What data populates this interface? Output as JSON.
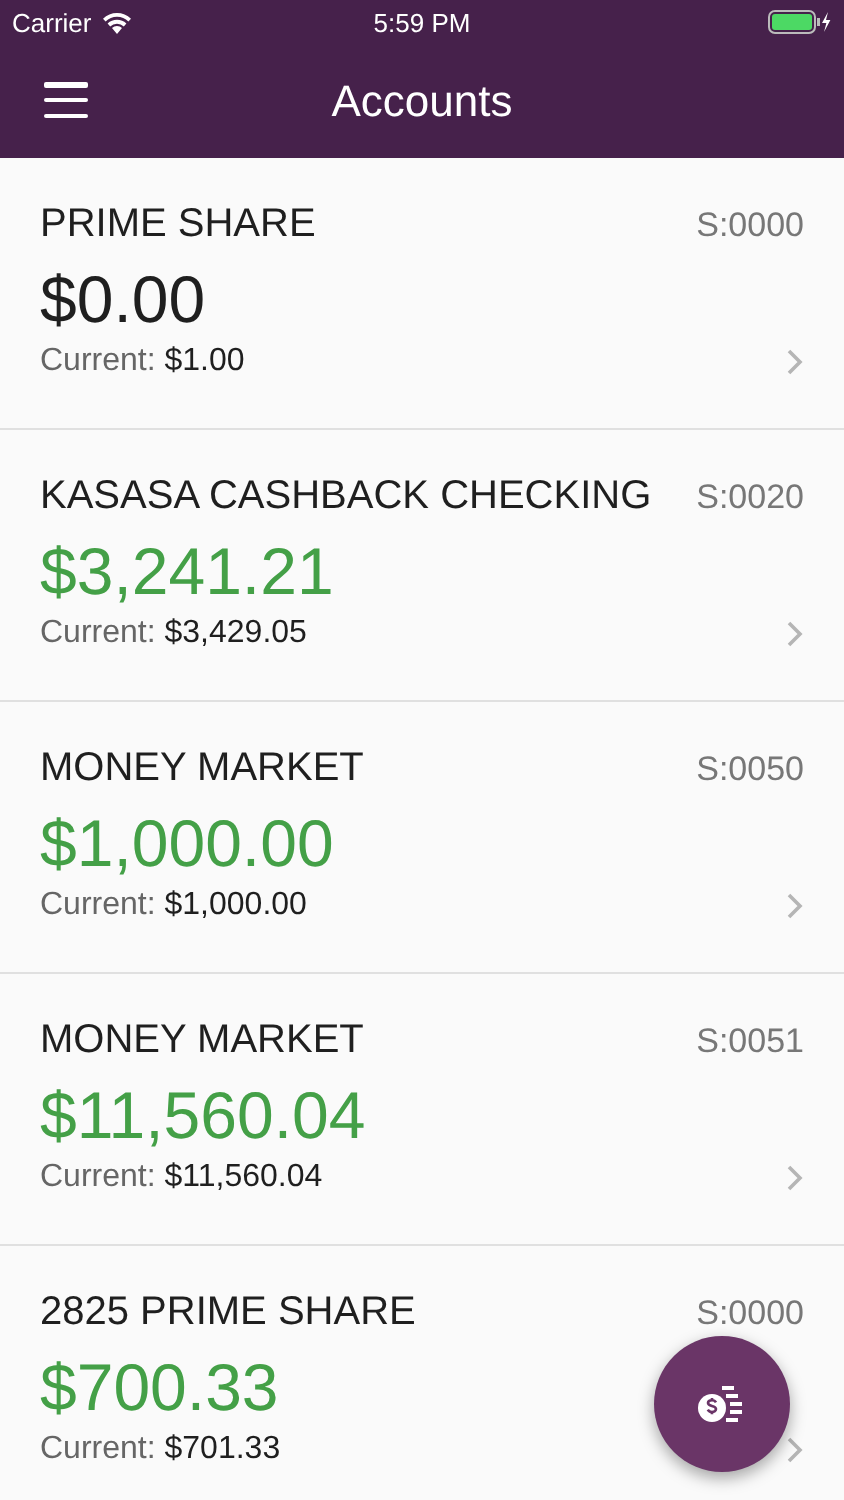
{
  "status_bar": {
    "carrier": "Carrier",
    "time": "5:59 PM"
  },
  "header": {
    "title": "Accounts"
  },
  "accounts": [
    {
      "name": "PRIME SHARE",
      "code": "S:0000",
      "balance": "$0.00",
      "color": "#1f1f1f",
      "current_label": "Current:",
      "current": "$1.00"
    },
    {
      "name": "KASASA CASHBACK CHECKING",
      "code": "S:0020",
      "balance": "$3,241.21",
      "color": "#44a047",
      "current_label": "Current:",
      "current": "$3,429.05"
    },
    {
      "name": "MONEY MARKET",
      "code": "S:0050",
      "balance": "$1,000.00",
      "color": "#44a047",
      "current_label": "Current:",
      "current": "$1,000.00"
    },
    {
      "name": "MONEY MARKET",
      "code": "S:0051",
      "balance": "$11,560.04",
      "color": "#44a047",
      "current_label": "Current:",
      "current": "$11,560.04"
    },
    {
      "name": "2825 PRIME SHARE",
      "code": "S:0000",
      "balance": "$700.33",
      "color": "#44a047",
      "current_label": "Current:",
      "current": "$701.33"
    }
  ]
}
